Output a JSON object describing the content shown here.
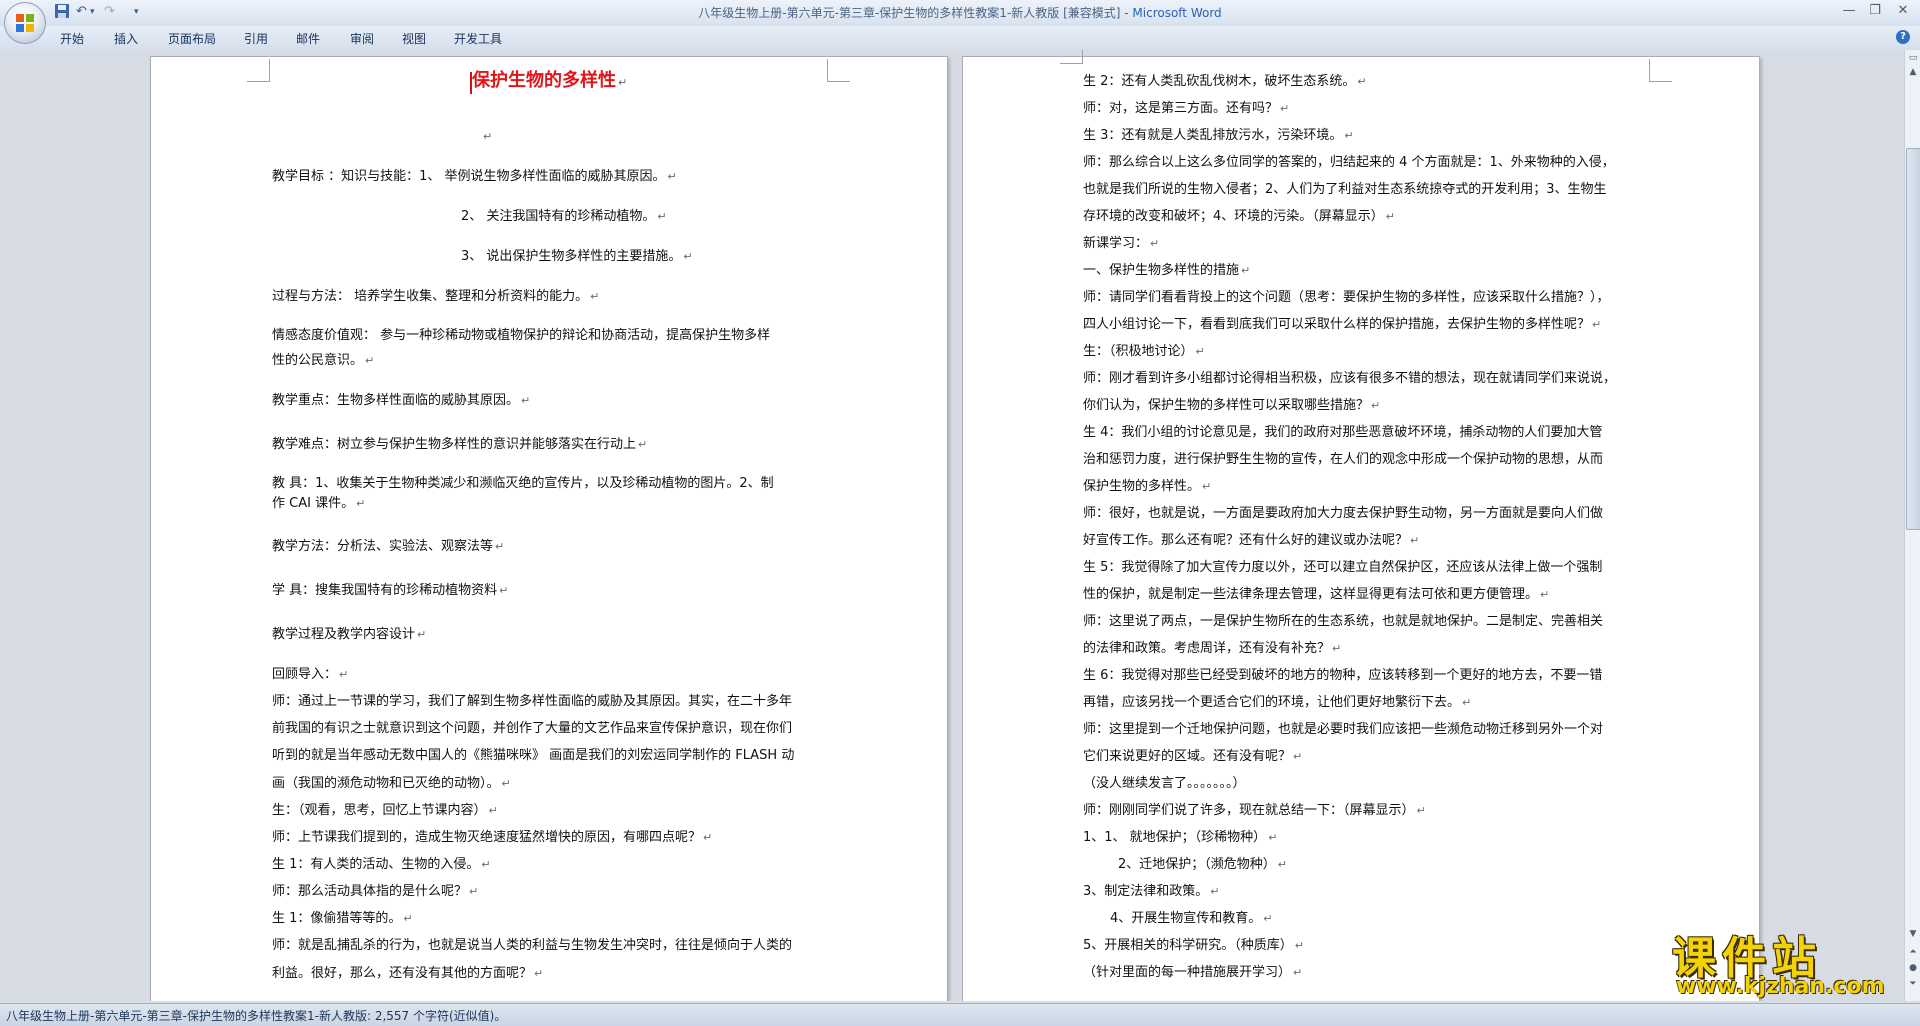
{
  "window": {
    "title": "八年级生物上册-第六单元-第三章-保护生物的多样性教案1-新人教版 [兼容模式] - ",
    "app_name": "Microsoft Word",
    "quick_access": [
      "save-icon",
      "undo-icon",
      "redo-icon",
      "customize-icon"
    ]
  },
  "ribbon": {
    "tabs": [
      "开始",
      "插入",
      "页面布局",
      "引用",
      "邮件",
      "审阅",
      "视图",
      "开发工具"
    ]
  },
  "paragraph_mark": "↵",
  "left_page": [
    "保护生物的多样性",
    "",
    "教学目标 ：知识与技能：1、        举例说生物多样性面临的威胁其原因。",
    "2、        关注我国特有的珍稀动植物。",
    "3、        说出保护生物多样性的主要措施。",
    "过程与方法：      培养学生收集、整理和分析资料的能力。",
    "情感态度价值观：    参与一种珍稀动物或植物保护的辩论和协商活动，提高保护生物多样",
    "性的公民意识。",
    "教学重点：生物多样性面临的威胁其原因。",
    "教学难点：树立参与保护生物多样性的意识并能够落实在行动上",
    "教    具：1、收集关于生物种类减少和濒临灭绝的宣传片，以及珍稀动植物的图片。2、制",
    "作 CAI 课件。",
    "教学方法：分析法、实验法、观察法等",
    "学    具：搜集我国特有的珍稀动植物资料",
    "教学过程及教学内容设计",
    "回顾导入：",
    "师：通过上一节课的学习，我们了解到生物多样性面临的威胁及其原因。其实，在二十多年",
    "前我国的有识之士就意识到这个问题，并创作了大量的文艺作品来宣传保护意识，现在你们",
    "听到的就是当年感动无数中国人的《熊猫咪咪》 画面是我们的刘宏运同学制作的 FLASH 动",
    "画（我国的濒危动物和已灭绝的动物）。",
    "生：（观看，思考，回忆上节课内容）",
    "师：上节课我们提到的，造成生物灭绝速度猛然增快的原因，有哪四点呢？",
    "生 1：有人类的活动、生物的入侵。",
    "师：那么活动具体指的是什么呢？",
    "生 1：像偷猎等等的。",
    "师：就是乱捕乱杀的行为，也就是说当人类的利益与生物发生冲突时，往往是倾向于人类的",
    "利益。很好，那么，还有没有其他的方面呢？"
  ],
  "right_page": [
    "生 2：还有人类乱砍乱伐树木，破坏生态系统。",
    "师：对，这是第三方面。还有吗？",
    "生 3：还有就是人类乱排放污水，污染环境。",
    "师：那么综合以上这么多位同学的答案的，归结起来的 4 个方面就是：1、外来物种的入侵，",
    "也就是我们所说的生物入侵者；2、人们为了利益对生态系统掠夺式的开发利用；3、生物生",
    "存环境的改变和破坏；4、环境的污染。（屏幕显示）",
    "新课学习：",
    "一、保护生物多样性的措施",
    "师：请同学们看看背投上的这个问题（思考：要保护生物的多样性，应该采取什么措施？），",
    "四人小组讨论一下，看看到底我们可以采取什么样的保护措施，去保护生物的多样性呢？",
    "生：（积极地讨论）",
    "师：刚才看到许多小组都讨论得相当积极，应该有很多不错的想法，现在就请同学们来说说，",
    "你们认为，保护生物的多样性可以采取哪些措施？",
    "生 4：我们小组的讨论意见是，我们的政府对那些恶意破坏环境，捕杀动物的人们要加大管",
    "治和惩罚力度，进行保护野生生物的宣传，在人们的观念中形成一个保护动物的思想，从而",
    "保护生物的多样性。",
    "师：很好，也就是说，一方面是要政府加大力度去保护野生动物，另一方面就是要向人们做",
    "好宣传工作。那么还有呢？还有什么好的建议或办法呢？",
    "生 5：我觉得除了加大宣传力度以外，还可以建立自然保护区，还应该从法律上做一个强制",
    "性的保护，就是制定一些法律条理去管理，这样显得更有法可依和更方便管理。",
    "师：这里说了两点，一是保护生物所在的生态系统，也就是就地保护。二是制定、完善相关",
    "的法律和政策。考虑周详，还有没有补充？",
    "生 6：我觉得对那些已经受到破坏的地方的物种，应该转移到一个更好的地方去，不要一错",
    "再错，应该另找一个更适合它们的环境，让他们更好地繁衍下去。",
    "师：这里提到一个迁地保护问题，也就是必要时我们应该把一些濒危动物迁移到另外一个对",
    "它们来说更好的区域。还有没有呢？",
    "（没人继续发言了。。。。。。。）",
    "师：刚刚同学们说了许多，现在就总结一下：（屏幕显示）",
    "1、1、    就地保护；（珍稀物种）",
    "2、迁地保护；（濒危物种）",
    "3、制定法律和政策。",
    "4、开展生物宣传和教育。",
    "5、开展相关的科学研究。（种质库）",
    "（针对里面的每一种措施展开学习）"
  ],
  "status_bar": {
    "text": "八年级生物上册-第六单元-第三章-保护生物的多样性教案1-新人教版: 2,557 个字符(近似值)。"
  },
  "watermark": {
    "name": "课件站",
    "url": "www.kjzhan.com"
  },
  "colors": {
    "title_red": "#e0161b",
    "watermark_yellow": "#f4d20a",
    "word_blue": "#2a62b6"
  }
}
